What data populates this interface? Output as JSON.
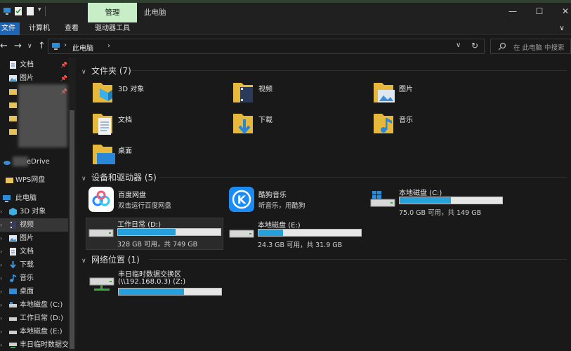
{
  "titlebar": {
    "manage_tab": "管理",
    "window_title": "此电脑",
    "minimize": "—",
    "maximize": "☐",
    "close": "✕"
  },
  "ribbon": {
    "tabs": [
      "文件",
      "计算机",
      "查看",
      "驱动器工具"
    ],
    "chevron": "∨"
  },
  "nav": {
    "back": "←",
    "forward": "→",
    "recent": "∨",
    "up": "↑",
    "breadcrumb_sep": "›",
    "location": "此电脑",
    "refresh": "↻",
    "dropdown": "∨",
    "search_placeholder": "在 此电脑 中搜索"
  },
  "sidebar": {
    "items": [
      {
        "label": "文档",
        "icon": "documents-icon",
        "pinned": true
      },
      {
        "label": "图片",
        "icon": "pictures-icon",
        "pinned": true
      },
      {
        "label": "",
        "icon": "folder-icon",
        "pinned": true
      },
      {
        "label": "",
        "icon": "folder-icon",
        "pinned": false
      },
      {
        "label": "",
        "icon": "folder-icon",
        "pinned": false
      },
      {
        "label": "",
        "icon": "folder-icon",
        "pinned": false
      },
      {
        "label": "eDrive",
        "icon": "onedrive-icon",
        "pinned": false
      },
      {
        "label": "WPS网盘",
        "icon": "folder-icon",
        "pinned": false
      },
      {
        "label": "此电脑",
        "icon": "computer-icon",
        "pinned": false
      },
      {
        "label": "3D 对象",
        "icon": "3d-objects-icon",
        "pinned": false
      },
      {
        "label": "视频",
        "icon": "videos-icon",
        "pinned": false
      },
      {
        "label": "图片",
        "icon": "pictures-icon",
        "pinned": false
      },
      {
        "label": "文档",
        "icon": "documents-icon",
        "pinned": false
      },
      {
        "label": "下载",
        "icon": "downloads-icon",
        "pinned": false
      },
      {
        "label": "音乐",
        "icon": "music-icon",
        "pinned": false
      },
      {
        "label": "桌面",
        "icon": "desktop-icon",
        "pinned": false
      },
      {
        "label": "本地磁盘 (C:)",
        "icon": "drive-icon",
        "pinned": false
      },
      {
        "label": "工作日常 (D:)",
        "icon": "drive-icon",
        "pinned": false
      },
      {
        "label": "本地磁盘 (E:)",
        "icon": "drive-icon",
        "pinned": false
      },
      {
        "label": "丰日临时数据交",
        "icon": "network-drive-icon",
        "pinned": false
      }
    ]
  },
  "folders": {
    "header": "文件夹 (7)",
    "items": [
      {
        "name": "3D 对象",
        "icon": "3d-objects-folder-icon"
      },
      {
        "name": "视频",
        "icon": "videos-folder-icon"
      },
      {
        "name": "图片",
        "icon": "pictures-folder-icon"
      },
      {
        "name": "文档",
        "icon": "documents-folder-icon"
      },
      {
        "name": "下载",
        "icon": "downloads-folder-icon"
      },
      {
        "name": "音乐",
        "icon": "music-folder-icon"
      },
      {
        "name": "桌面",
        "icon": "desktop-folder-icon"
      }
    ]
  },
  "devices": {
    "header": "设备和驱动器 (5)",
    "apps": [
      {
        "name": "百度网盘",
        "desc": "双击运行百度网盘",
        "icon": "baidu-netdisk-icon"
      },
      {
        "name": "酷狗音乐",
        "desc": "听音乐，用酷狗",
        "icon": "kugou-music-icon",
        "letter": "K"
      }
    ],
    "drives": [
      {
        "name": "本地磁盘 (C:)",
        "info": "75.0 GB 可用，共 149 GB",
        "used_fraction": 0.5
      },
      {
        "name": "工作日常 (D:)",
        "info": "328 GB 可用，共 749 GB",
        "used_fraction": 0.56
      },
      {
        "name": "本地磁盘 (E:)",
        "info": "24.3 GB 可用，共 31.9 GB",
        "used_fraction": 0.24
      }
    ]
  },
  "network": {
    "header": "网络位置 (1)",
    "items": [
      {
        "name": "丰日临时数据交换区",
        "path": "(\\\\192.168.0.3) (Z:)",
        "used_fraction": 0.64
      }
    ]
  },
  "colors": {
    "accent": "#1f64b5",
    "bar_fill": "#26a0da",
    "manage_tab": "#c8eec8",
    "background": "#191919"
  }
}
